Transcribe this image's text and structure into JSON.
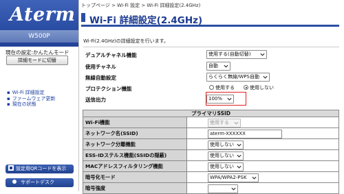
{
  "brand": {
    "logo": "Aterm",
    "model": "W500P"
  },
  "sidebar": {
    "mode_text": "現在の設定:かんたんモード",
    "detail_button": "詳細モードに切替",
    "nav": [
      "Wi-Fi 詳細設定",
      "ファームウェア更新",
      "現在の状態"
    ],
    "qr_button": "設定用QRコードを表示",
    "support_button": "サポートデスク"
  },
  "header": {
    "breadcrumb": "トップページ > Wi-Fi 設定 > Wi-Fi 詳細設定(2.4GHz)",
    "title": "Wi-Fi 詳細設定(2.4GHz)",
    "description": "Wi-Fi(2.4GHz)の詳細設定を行います。"
  },
  "form": {
    "dual_channel": {
      "label": "デュアルチャネル機能",
      "value": "使用する(自動切替)"
    },
    "channel": {
      "label": "使用チャネル",
      "value": "自動"
    },
    "auto_setting": {
      "label": "無線自動設定",
      "value": "らくらく無線/WPS自動"
    },
    "protection": {
      "label": "プロテクション機能",
      "option_on": "使用する",
      "option_off": "使用しない",
      "selected": "使用しない"
    },
    "tx_power": {
      "label": "送信出力",
      "value": "100%"
    }
  },
  "table": {
    "heading": "プライマリSSID",
    "rows": [
      {
        "label": "Wi-Fi機能",
        "value": "使用する",
        "kind": "select-disabled"
      },
      {
        "label": "ネットワーク名(SSID)",
        "value": "aterm-XXXXXX",
        "kind": "text"
      },
      {
        "label": "ネットワーク分離機能",
        "value": "使用しない",
        "kind": "select"
      },
      {
        "label": "ESS-IDステルス機能(SSIDの隠蔽)",
        "value": "使用しない",
        "kind": "select"
      },
      {
        "label": "MACアドレスフィルタリング機能",
        "value": "使用しない",
        "kind": "select"
      },
      {
        "label": "暗号化モード",
        "value": "WPA/WPA2-PSK",
        "kind": "select"
      },
      {
        "label": "暗号強度",
        "value": "",
        "kind": "select"
      }
    ]
  },
  "colors": {
    "brand_blue": "#2b4ea5",
    "highlight_red": "#e02020",
    "link_blue": "#1a3ea3"
  }
}
